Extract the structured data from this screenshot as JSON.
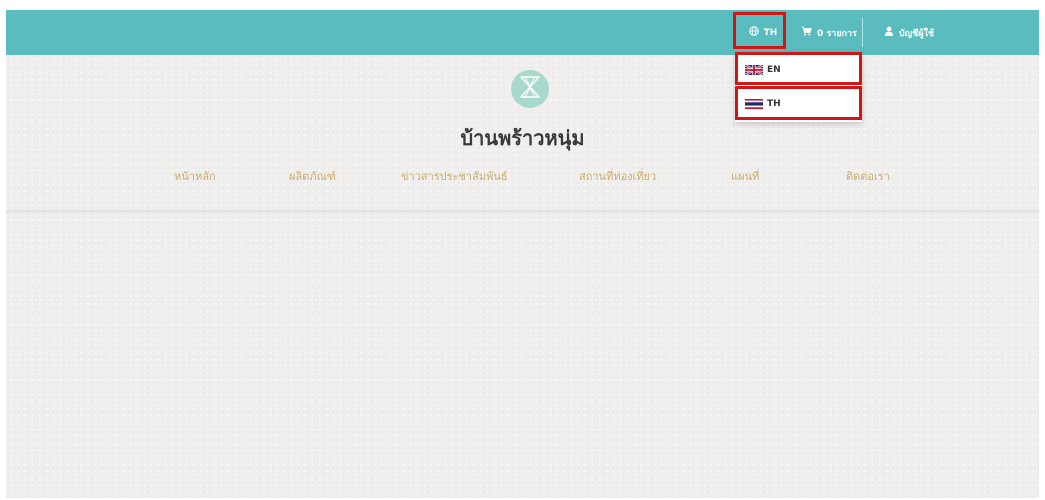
{
  "topbar": {
    "language": {
      "icon": "globe-icon",
      "label": "TH"
    },
    "cart": {
      "icon": "cart-icon",
      "label": "0 รายการ"
    },
    "account": {
      "icon": "user-icon",
      "label": "บัญชีผู้ใช้"
    }
  },
  "language_menu": {
    "items": [
      {
        "code": "EN",
        "flag": "uk-flag-icon"
      },
      {
        "code": "TH",
        "flag": "thai-flag-icon"
      }
    ]
  },
  "site": {
    "title": "บ้านพร้าวหนุ่ม",
    "logo_icon": "hourglass-logo-icon"
  },
  "nav": {
    "items": [
      "หน้าหลัก",
      "ผลิตภัณฑ์",
      "ข่าวสารประชาสัมพันธ์",
      "สถานที่ท่องเที่ยว",
      "แผนที่",
      "ติดต่อเรา"
    ]
  },
  "colors": {
    "topbar": "#5bbcbf",
    "nav_text": "#c9ac72",
    "highlight": "#d11616",
    "logo": "#a9d9cc"
  }
}
